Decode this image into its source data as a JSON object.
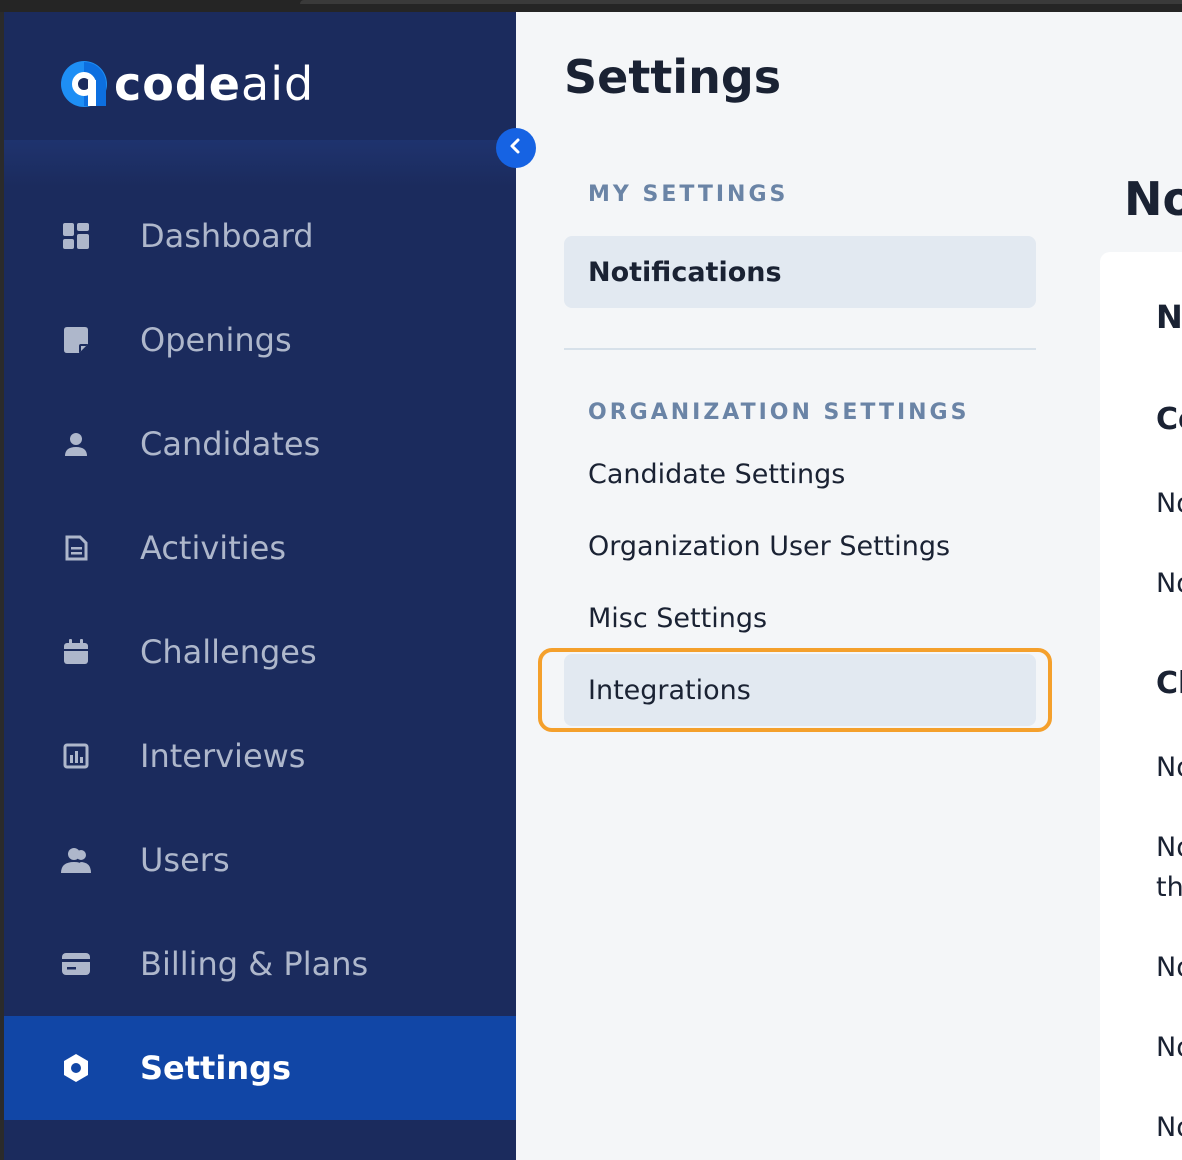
{
  "brand": {
    "name_bold": "code",
    "name_light": "aid"
  },
  "sidebar": {
    "items": [
      {
        "label": "Dashboard",
        "icon": "dashboard-icon"
      },
      {
        "label": "Openings",
        "icon": "openings-icon"
      },
      {
        "label": "Candidates",
        "icon": "person-icon"
      },
      {
        "label": "Activities",
        "icon": "document-icon"
      },
      {
        "label": "Challenges",
        "icon": "calendar-icon"
      },
      {
        "label": "Interviews",
        "icon": "chart-icon"
      },
      {
        "label": "Users",
        "icon": "users-icon"
      },
      {
        "label": "Billing & Plans",
        "icon": "card-icon"
      },
      {
        "label": "Settings",
        "icon": "gear-icon",
        "active": true
      }
    ]
  },
  "settings": {
    "title": "Settings",
    "my_settings_header": "MY SETTINGS",
    "my_settings_items": [
      "Notifications"
    ],
    "org_settings_header": "ORGANIZATION SETTINGS",
    "org_settings_items": [
      "Candidate Settings",
      "Organization User Settings",
      "Misc Settings",
      "Integrations"
    ]
  },
  "content": {
    "title": "No",
    "card_heading": "N",
    "section_a": "Co",
    "rows_a": [
      "No",
      "No"
    ],
    "section_b": "Cl",
    "rows_b": [
      "No",
      "No",
      "th",
      "No",
      "No",
      "No"
    ]
  },
  "colors": {
    "sidebar": "#1b2b5d",
    "active": "#1146a6",
    "highlight": "#f4a02c",
    "accent": "#1663e3"
  }
}
